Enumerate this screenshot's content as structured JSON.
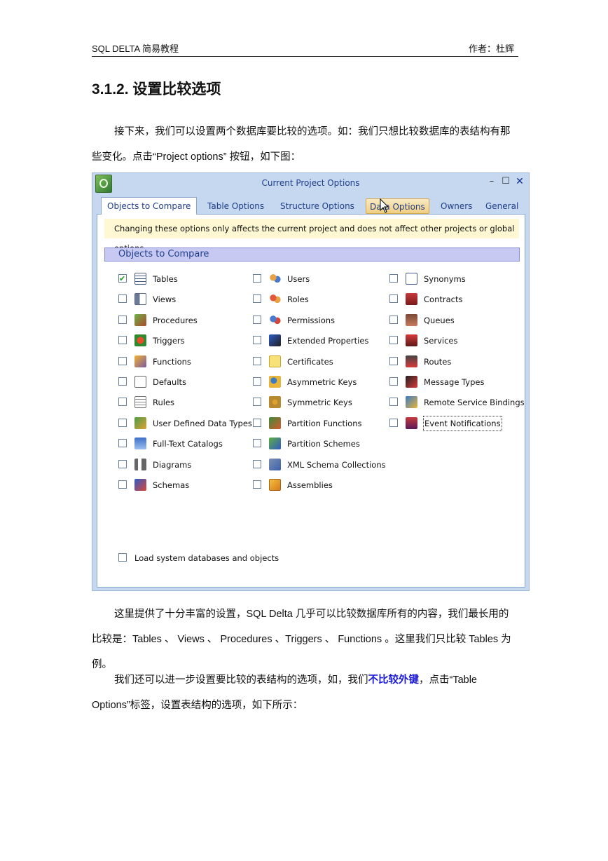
{
  "header": {
    "left": "SQL DELTA 简易教程",
    "right": "作者：杜辉"
  },
  "section_title": "3.1.2. 设置比较选项",
  "paragraph1": "接下来，我们可以设置两个数据库要比较的选项。如：我们只想比较数据库的表结构有那些变化。点击“Project options” 按钮，如下图：",
  "dialog": {
    "title": "Current Project Options",
    "window_buttons": {
      "minimize": "–",
      "maximize": "☐",
      "close": "✕"
    },
    "tabs": [
      {
        "label": "Objects to Compare",
        "state": "active"
      },
      {
        "label": "Table Options"
      },
      {
        "label": "Structure Options"
      },
      {
        "label": "Data Options",
        "state": "hover"
      },
      {
        "label": "Owners"
      },
      {
        "label": "General"
      }
    ],
    "notice": "Changing these options only affects the current project and does not affect other projects or global options",
    "group_title": "Objects to Compare",
    "col1": [
      {
        "label": "Tables",
        "icon": "table-icon",
        "checked": true
      },
      {
        "label": "Views",
        "icon": "view-icon",
        "checked": false
      },
      {
        "label": "Procedures",
        "icon": "procedure-icon",
        "checked": false
      },
      {
        "label": "Triggers",
        "icon": "trigger-icon",
        "checked": false
      },
      {
        "label": "Functions",
        "icon": "function-icon",
        "checked": false
      },
      {
        "label": "Defaults",
        "icon": "default-icon",
        "checked": false
      },
      {
        "label": "Rules",
        "icon": "rule-icon",
        "checked": false
      },
      {
        "label": "User Defined Data Types",
        "icon": "user-defined-type-icon",
        "checked": false
      },
      {
        "label": "Full-Text Catalogs",
        "icon": "fulltext-catalog-icon",
        "checked": false
      },
      {
        "label": "Diagrams",
        "icon": "diagram-icon",
        "checked": false
      },
      {
        "label": "Schemas",
        "icon": "schema-icon",
        "checked": false
      }
    ],
    "col2": [
      {
        "label": "Users",
        "icon": "users-icon",
        "checked": false
      },
      {
        "label": "Roles",
        "icon": "roles-icon",
        "checked": false
      },
      {
        "label": "Permissions",
        "icon": "permissions-icon",
        "checked": false
      },
      {
        "label": "Extended Properties",
        "icon": "extended-properties-icon",
        "checked": false
      },
      {
        "label": "Certificates",
        "icon": "certificate-icon",
        "checked": false
      },
      {
        "label": "Asymmetric Keys",
        "icon": "asymmetric-key-icon",
        "checked": false
      },
      {
        "label": "Symmetric Keys",
        "icon": "symmetric-key-icon",
        "checked": false
      },
      {
        "label": "Partition Functions",
        "icon": "partition-function-icon",
        "checked": false
      },
      {
        "label": "Partition Schemes",
        "icon": "partition-scheme-icon",
        "checked": false
      },
      {
        "label": "XML Schema Collections",
        "icon": "xml-schema-icon",
        "checked": false
      },
      {
        "label": "Assemblies",
        "icon": "assembly-icon",
        "checked": false
      }
    ],
    "col3": [
      {
        "label": "Synonyms",
        "icon": "synonym-icon",
        "checked": false
      },
      {
        "label": "Contracts",
        "icon": "contract-icon",
        "checked": false
      },
      {
        "label": "Queues",
        "icon": "queue-icon",
        "checked": false
      },
      {
        "label": "Services",
        "icon": "service-icon",
        "checked": false
      },
      {
        "label": "Routes",
        "icon": "route-icon",
        "checked": false
      },
      {
        "label": "Message Types",
        "icon": "message-type-icon",
        "checked": false
      },
      {
        "label": "Remote Service Bindings",
        "icon": "remote-service-binding-icon",
        "checked": false
      },
      {
        "label": "Event Notifications",
        "icon": "event-notification-icon",
        "checked": false,
        "focused": true
      }
    ],
    "load_system": "Load system databases and objects"
  },
  "paragraph2": "这里提供了十分丰富的设置，SQL Delta 几乎可以比较数据库所有的内容，我们最长用的比较是：Tables 、 Views 、 Procedures 、Triggers 、 Functions 。这里我们只比较 Tables 为例。",
  "paragraph3": {
    "before": "我们还可以进一步设置要比较的表结构的选项，如，我们",
    "highlight": "不比较外键",
    "after": "，点击“Table Options”标签，设置表结构的选项，如下所示："
  }
}
